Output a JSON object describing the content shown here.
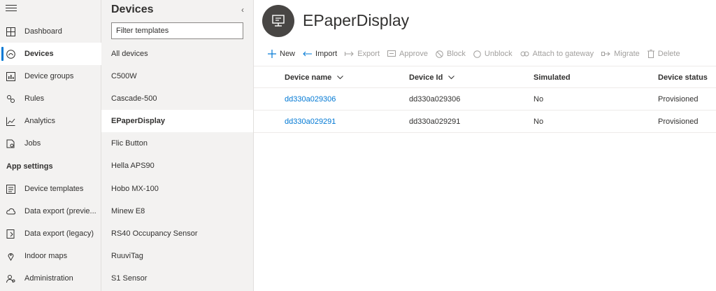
{
  "nav": {
    "items": [
      {
        "label": "Dashboard",
        "icon": "dashboard-icon"
      },
      {
        "label": "Devices",
        "icon": "devices-icon",
        "active": true
      },
      {
        "label": "Device groups",
        "icon": "device-groups-icon"
      },
      {
        "label": "Rules",
        "icon": "rules-icon"
      },
      {
        "label": "Analytics",
        "icon": "analytics-icon"
      },
      {
        "label": "Jobs",
        "icon": "jobs-icon"
      }
    ],
    "section_label": "App settings",
    "settings_items": [
      {
        "label": "Device templates",
        "icon": "device-templates-icon"
      },
      {
        "label": "Data export (previe...",
        "icon": "data-export-icon"
      },
      {
        "label": "Data export (legacy)",
        "icon": "data-export-legacy-icon"
      },
      {
        "label": "Indoor maps",
        "icon": "indoor-maps-icon"
      },
      {
        "label": "Administration",
        "icon": "administration-icon"
      }
    ]
  },
  "templates": {
    "title": "Devices",
    "filter_placeholder": "Filter templates",
    "items": [
      "All devices",
      "C500W",
      "Cascade-500",
      "EPaperDisplay",
      "Flic Button",
      "Hella APS90",
      "Hobo MX-100",
      "Minew E8",
      "RS40 Occupancy Sensor",
      "RuuviTag",
      "S1 Sensor"
    ],
    "active_index": 3
  },
  "main": {
    "title": "EPaperDisplay",
    "toolbar": [
      {
        "label": "New",
        "icon": "plus-icon",
        "enabled": true
      },
      {
        "label": "Import",
        "icon": "import-icon",
        "enabled": true
      },
      {
        "label": "Export",
        "icon": "export-icon",
        "enabled": false
      },
      {
        "label": "Approve",
        "icon": "approve-icon",
        "enabled": false
      },
      {
        "label": "Block",
        "icon": "block-icon",
        "enabled": false
      },
      {
        "label": "Unblock",
        "icon": "unblock-icon",
        "enabled": false
      },
      {
        "label": "Attach to gateway",
        "icon": "attach-icon",
        "enabled": false
      },
      {
        "label": "Migrate",
        "icon": "migrate-icon",
        "enabled": false
      },
      {
        "label": "Delete",
        "icon": "delete-icon",
        "enabled": false
      }
    ],
    "columns": [
      "Device name",
      "Device Id",
      "Simulated",
      "Device status"
    ],
    "rows": [
      [
        "dd330a029306",
        "dd330a029306",
        "No",
        "Provisioned"
      ],
      [
        "dd330a029291",
        "dd330a029291",
        "No",
        "Provisioned"
      ]
    ]
  },
  "colors": {
    "accent": "#0078d4",
    "nav_bg": "#f3f2f1",
    "avatar_bg": "#484644"
  }
}
